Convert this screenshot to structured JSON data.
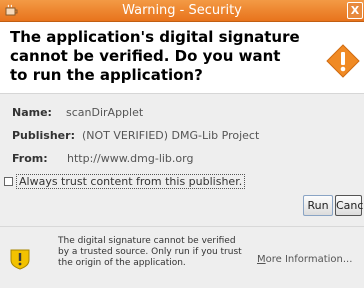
{
  "window": {
    "title": "Warning - Security",
    "close_glyph": "X"
  },
  "header": {
    "question": "The application's digital signature cannot be verified.  Do you want to run the application?",
    "icon": "warning-diamond-icon",
    "icon_color": "#f08a24"
  },
  "details": [
    {
      "label": "Name:",
      "value": "scanDirApplet"
    },
    {
      "label": "Publisher:",
      "value": "(NOT VERIFIED) DMG-Lib Project"
    },
    {
      "label": "From:",
      "value": "http://www.dmg-lib.org"
    }
  ],
  "trust_checkbox": {
    "label": "Always trust content from this publisher.",
    "checked": false
  },
  "buttons": {
    "run": "Run",
    "cancel": "Cancel"
  },
  "footer": {
    "message": "The digital signature cannot be verified by a trusted source.  Only run if you trust the origin of the application.",
    "more_info_first": "M",
    "more_info_rest": "ore Information..."
  }
}
